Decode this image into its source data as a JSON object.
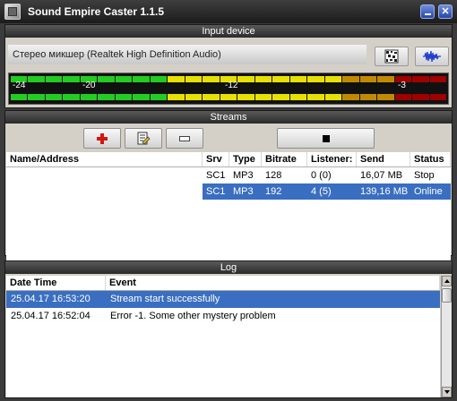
{
  "window": {
    "title": "Sound Empire Caster 1.1.5"
  },
  "input_device": {
    "header": "Input device",
    "device_name": "Стерео микшер (Realtek High Definition Audio)",
    "meter": {
      "labels": [
        "-24",
        "-20",
        "-12",
        "-3"
      ]
    }
  },
  "streams": {
    "header": "Streams",
    "columns": [
      "Name/Address",
      "Srv",
      "Type",
      "Bitrate",
      "Listener:",
      "Send",
      "Status"
    ],
    "rows": [
      {
        "name": "",
        "srv": "SC1",
        "type": "MP3",
        "bitrate": "128",
        "listeners": "0 (0)",
        "send": "16,07 MB",
        "status": "Stop"
      },
      {
        "name": "",
        "srv": "SC1",
        "type": "MP3",
        "bitrate": "192",
        "listeners": "4 (5)",
        "send": "139,16 MB",
        "status": "Online"
      }
    ]
  },
  "log": {
    "header": "Log",
    "columns": [
      "Date Time",
      "Event"
    ],
    "rows": [
      {
        "datetime": "25.04.17 16:53:20",
        "event": "Stream start successfully"
      },
      {
        "datetime": "25.04.17 16:52:04",
        "event": "Error -1. Some other mystery problem"
      }
    ]
  },
  "colors": {
    "selection": "#3a6ec0",
    "meter_green": "#22cc22",
    "meter_yellow": "#e8e000",
    "meter_orange": "#c08a00",
    "meter_red": "#a00000"
  }
}
